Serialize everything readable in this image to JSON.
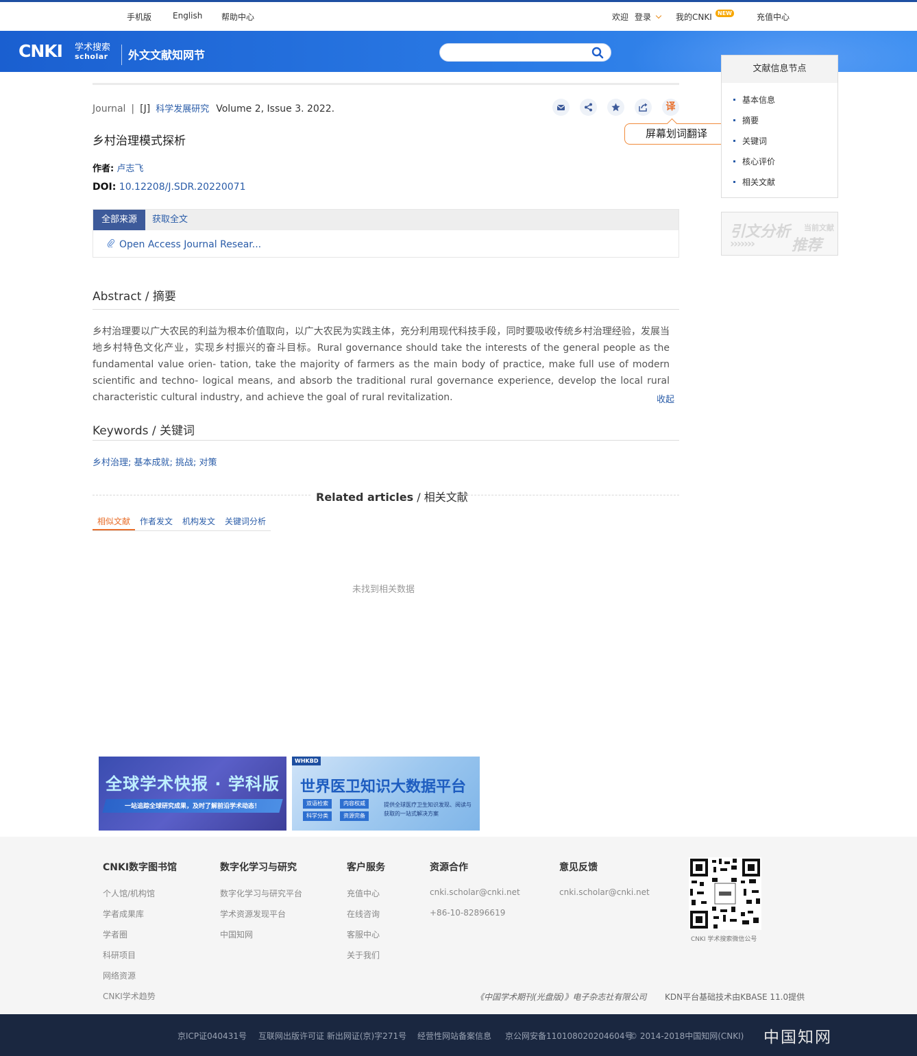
{
  "topbar": {
    "mobile": "手机版",
    "english": "English",
    "help": "帮助中心",
    "welcome": "欢迎",
    "login": "登录",
    "my_cnki": "我的CNKI",
    "new_badge": "NEW",
    "recharge": "充值中心"
  },
  "header": {
    "logo_main": "CNKI",
    "logo_sub_cn": "学术搜索",
    "logo_sub_en": "scholar",
    "section_title": "外文文献知网节",
    "search_placeholder": "",
    "brand_color": "#1a5fd0"
  },
  "article": {
    "type": "Journal",
    "sep": "|",
    "tag": "[J]",
    "source": "科学发展研究",
    "volume": "Volume 2, Issue 3. 2022.",
    "title": "乡村治理模式探析",
    "author_label": "作者:",
    "author": "卢志飞",
    "doi_label": "DOI:",
    "doi": "10.12208/J.SDR.20220071"
  },
  "actions": {
    "translate_icon": "译",
    "tooltip": "屏幕划词翻译"
  },
  "sources": {
    "tab_all": "全部来源",
    "tab_fulltext": "获取全文",
    "link": "Open Access Journal Resear..."
  },
  "abstract": {
    "heading_en": "Abstract",
    "heading_sep": "/",
    "heading_cn": "摘要",
    "text": "乡村治理要以广大农民的利益为根本价值取向，以广大农民为实践主体，充分利用现代科技手段，同时要吸收传统乡村治理经验，发展当地乡村特色文化产业，实现乡村振兴的奋斗目标。Rural governance should take the interests of the general people as the fundamental value orien- tation, take the majority of farmers as the main body of practice, make full use of modern scientific and techno- logical means, and absorb the traditional rural governance experience, develop the local rural characteristic cultural industry, and achieve the goal of rural revitalization.",
    "collapse": "收起"
  },
  "keywords": {
    "heading_en": "Keywords",
    "heading_sep": "/",
    "heading_cn": "关键词",
    "text": "乡村治理; 基本成就; 挑战; 对策"
  },
  "related": {
    "title_en": "Related articles",
    "title_sep": "/",
    "title_cn": "相关文献",
    "tabs": [
      "相似文献",
      "作者发文",
      "机构发文",
      "关键词分析"
    ],
    "empty": "未找到相关数据"
  },
  "sidebar": {
    "heading": "文献信息节点",
    "items": [
      "基本信息",
      "摘要",
      "关键词",
      "核心评价",
      "相关文献"
    ],
    "cite_t1": "引文分析",
    "cite_t2": "当前文献",
    "cite_arrows": "›››››››",
    "cite_t3": "推荐"
  },
  "banners": {
    "b1_title": "全球学术快报 · 学科版",
    "b1_sub": "一站追踪全球研究成果，及时了解前沿学术动态！",
    "b2_badge": "WHKBD",
    "b2_title": "世界医卫知识大数据平台",
    "b2_pills": [
      "双语检索",
      "内容权威",
      "科学分类",
      "资源完备"
    ],
    "b2_desc": "提供全球医疗卫生知识发现、阅读与获取的一站式解决方案"
  },
  "footer": {
    "cols": [
      {
        "heading": "CNKI数字图书馆",
        "links": [
          "个人馆/机构馆",
          "学者成果库",
          "学者圈",
          "科研项目",
          "网络资源",
          "CNKI学术趋势"
        ]
      },
      {
        "heading": "数字化学习与研究",
        "links": [
          "数字化学习与研究平台",
          "学术资源发现平台",
          "中国知网"
        ]
      },
      {
        "heading": "客户服务",
        "links": [
          "充值中心",
          "在线咨询",
          "客服中心",
          "关于我们"
        ]
      },
      {
        "heading": "资源合作",
        "links": [
          "cnki.scholar@cnki.net",
          "+86-10-82896619"
        ]
      },
      {
        "heading": "意见反馈",
        "links": [
          "cnki.scholar@cnki.net"
        ]
      }
    ],
    "qr_caption": "CNKI 学术搜索微信公号",
    "publisher": "《中国学术期刊(光盘版)》电子杂志社有限公司",
    "kdn": "KDN平台基础技术由KBASE 11.0提供"
  },
  "bottom": {
    "icp": "京ICP证040431号",
    "publish_license": "互联网出版许可证 新出网证(京)字271号",
    "business": "经营性网站备案信息",
    "police": "京公网安备110108020204604号",
    "copyright": "© 2014-2018中国知网(CNKI)",
    "brand": "中国知网"
  }
}
